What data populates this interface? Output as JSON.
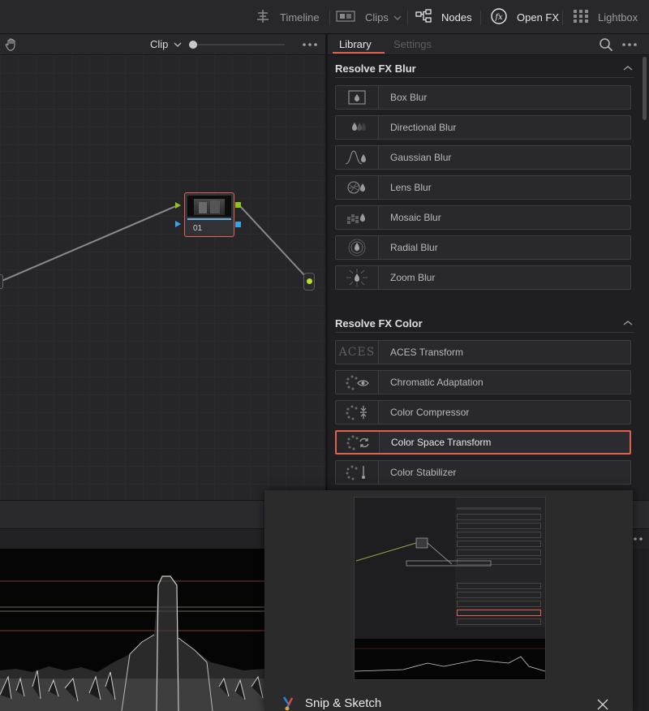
{
  "toolbar": {
    "items": [
      {
        "label": "Timeline",
        "icon": "timeline-icon"
      },
      {
        "label": "Clips",
        "icon": "clips-icon"
      },
      {
        "label": "Nodes",
        "icon": "nodes-icon"
      },
      {
        "label": "Open FX",
        "icon": "fx-icon"
      },
      {
        "label": "Lightbox",
        "icon": "lightbox-icon"
      }
    ]
  },
  "node_editor": {
    "mode_label": "Clip",
    "node_label": "01"
  },
  "library": {
    "tabs": [
      "Library",
      "Settings"
    ],
    "sections": [
      {
        "title": "Resolve FX Blur",
        "items": [
          "Box Blur",
          "Directional Blur",
          "Gaussian Blur",
          "Lens Blur",
          "Mosaic Blur",
          "Radial Blur",
          "Zoom Blur"
        ]
      },
      {
        "title": "Resolve FX Color",
        "items": [
          "ACES Transform",
          "Chromatic Adaptation",
          "Color Compressor",
          "Color Space Transform",
          "Color Stabilizer"
        ],
        "selected": "Color Space Transform"
      }
    ],
    "aces_thumb_text": "ACES"
  },
  "snip": {
    "title": "Snip & Sketch"
  },
  "colors": {
    "accent": "#e2604c",
    "node_input": "#8fc41d",
    "node_output": "#3aa3e8"
  }
}
